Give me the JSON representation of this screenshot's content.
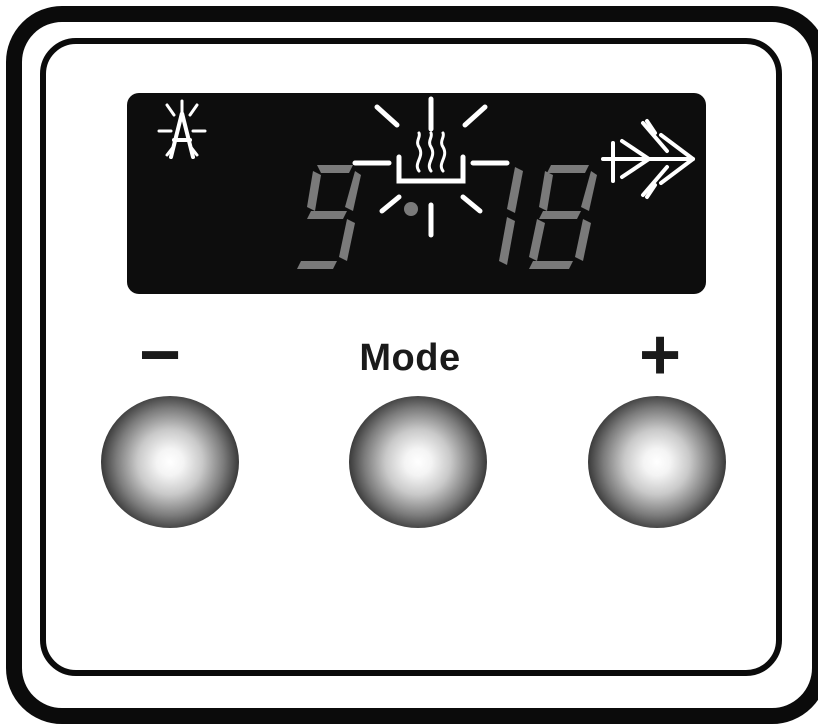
{
  "display": {
    "left_value": "9",
    "right_value": "18",
    "icons": [
      "auto-icon",
      "heater-icon",
      "fan-icon"
    ],
    "segment_color_on": "#7a7a7a",
    "segment_color_icons": "#ffffff",
    "background_color": "#0d0d0d"
  },
  "controls": {
    "minus_label": "−",
    "mode_label": "Mode",
    "plus_label": "+"
  }
}
